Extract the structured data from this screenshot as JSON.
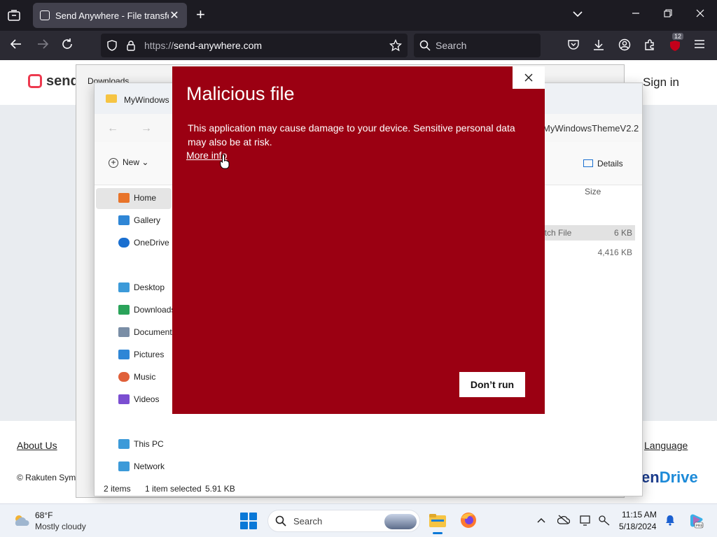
{
  "browser": {
    "tab_title": "Send Anywhere - File transfer",
    "url_prefix": "https://",
    "url_host": "send-anywhere.com",
    "search_placeholder": "Search",
    "extension_badge": "12"
  },
  "site": {
    "logo_text": "senda",
    "signin": "Sign in",
    "about_us": "About Us",
    "language": "Language",
    "copyright": "© Rakuten Symphon",
    "brand_right_part1": "en",
    "brand_right_part2": "Drive"
  },
  "downloads_window": {
    "title": "Downloads"
  },
  "explorer": {
    "title": "MyWindows",
    "address_tail": "MyWindowsThemeV2.2",
    "new_label": "New",
    "details_label": "Details",
    "size_header": "Size",
    "nav": [
      {
        "label": "Home",
        "icon": "home-icon",
        "color": "#e8742a"
      },
      {
        "label": "Gallery",
        "icon": "gallery-icon",
        "color": "#2f86d6"
      },
      {
        "label": "OneDrive",
        "icon": "onedrive-icon",
        "color": "#1a6fd0"
      },
      {
        "label": "Desktop",
        "icon": "desktop-icon",
        "color": "#3c9ad9"
      },
      {
        "label": "Downloads",
        "icon": "downloads-icon",
        "color": "#2aa35a"
      },
      {
        "label": "Document",
        "icon": "documents-icon",
        "color": "#7a8ea6"
      },
      {
        "label": "Pictures",
        "icon": "pictures-icon",
        "color": "#2f86d6"
      },
      {
        "label": "Music",
        "icon": "music-icon",
        "color": "#e0603a"
      },
      {
        "label": "Videos",
        "icon": "videos-icon",
        "color": "#7b4ed1"
      },
      {
        "label": "This PC",
        "icon": "this-pc-icon",
        "color": "#3c9ad9"
      },
      {
        "label": "Network",
        "icon": "network-icon",
        "color": "#3c9ad9"
      }
    ],
    "rows": [
      {
        "type": "atch File",
        "size": "6 KB",
        "selected": true
      },
      {
        "type": "",
        "size": "4,416 KB",
        "selected": false
      }
    ],
    "status_items": "2 items",
    "status_selected": "1 item selected",
    "status_size": "5.91 KB"
  },
  "dialog": {
    "title": "Malicious file",
    "message": "This application may cause damage to your device. Sensitive personal data may also be at risk.",
    "more_info": "More info",
    "dont_run": "Don’t run"
  },
  "taskbar": {
    "temperature": "68°F",
    "weather": "Mostly cloudy",
    "search_placeholder": "Search",
    "time": "11:15 AM",
    "date": "5/18/2024"
  }
}
